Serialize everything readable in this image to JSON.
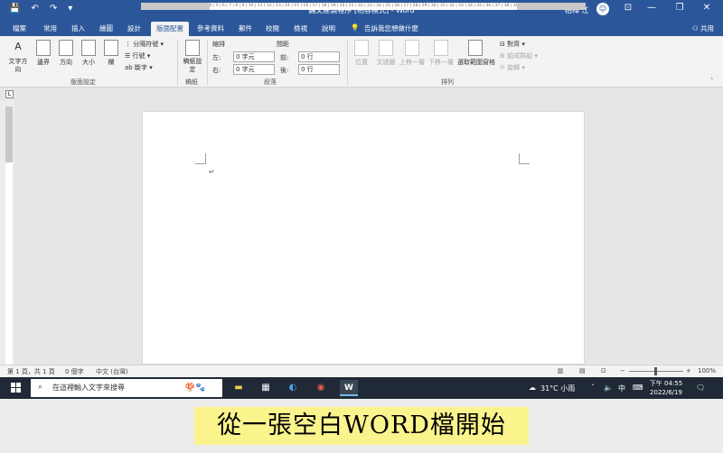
{
  "titlebar": {
    "title": "論文產製程序 [相容模式] - Word",
    "user": "柏樺 江",
    "avatar": "☺",
    "save_icon": "💾",
    "undo_icon": "↶",
    "redo_icon": "↷",
    "more_icon": "▾",
    "ribbon_display_icon": "⊡",
    "minimize": "—",
    "restore": "❐",
    "close": "✕"
  },
  "tabs": {
    "items": [
      "檔案",
      "常用",
      "插入",
      "繪圖",
      "設計",
      "版面配置",
      "參考資料",
      "郵件",
      "校閱",
      "檢視",
      "說明"
    ],
    "active": "版面配置",
    "tell_me": "告訴我您想做什麼",
    "tell_me_icon": "💡",
    "share": "共用",
    "share_icon": "⚇"
  },
  "ribbon": {
    "text_direction": "文字方向",
    "text_direction_icon": "A",
    "margins": "邊界",
    "orientation": "方向",
    "size": "大小",
    "columns": "欄",
    "breaks": "分隔符號",
    "line_numbers": "行號",
    "hyphenation": "斷字",
    "page_setup_label": "版面設定",
    "draft_settings": "稿紙設定",
    "draft_label": "稿紙",
    "indent_label": "縮排",
    "indent_left_label": "左:",
    "indent_left_value": "0 字元",
    "indent_right_label": "右:",
    "indent_right_value": "0 字元",
    "spacing_label": "間距",
    "spacing_before_label": "前:",
    "spacing_before_value": "0 行",
    "spacing_after_label": "後:",
    "spacing_after_value": "0 行",
    "paragraph_label": "段落",
    "position": "位置",
    "wrap_text": "文繞圖",
    "bring_forward": "上移一層",
    "send_backward": "下移一層",
    "selection_pane": "選取範圍窗格",
    "align": "對齊",
    "group": "組成群組",
    "rotate": "旋轉",
    "arrange_label": "排列"
  },
  "ruler": {
    "marks": "7 | 6 | 5 | 4 | 3 | 2 | 1 |   | 1 | 2 | 3 | 4 | 5 | 6 | 7 | 8 | 9 | 10 | 11 | 12 | 13 | 14 | 15 | 16 | 17 | 18 | 19 | 20 | 21 | 22 | 23 | 24 | 25 | 26 | 27 | 28 | 29 | 30 | 31 | 32 | 33 | 34 | 35 | 36 | 37 | 38 | 39 | 40 | 42"
  },
  "document": {
    "paragraph_mark": "↵"
  },
  "statusbar": {
    "page": "第 1 頁，共 1 頁",
    "words": "0 個字",
    "language": "中文 (台灣)",
    "zoom_minus": "−",
    "zoom_plus": "+",
    "zoom": "100%"
  },
  "taskbar": {
    "search_placeholder": "在這裡輸入文字來搜尋",
    "weather": "31°C 小雨",
    "ime": "中",
    "time": "下午 04:55",
    "date": "2022/6/19"
  },
  "caption": "從一張空白WORD檔開始"
}
